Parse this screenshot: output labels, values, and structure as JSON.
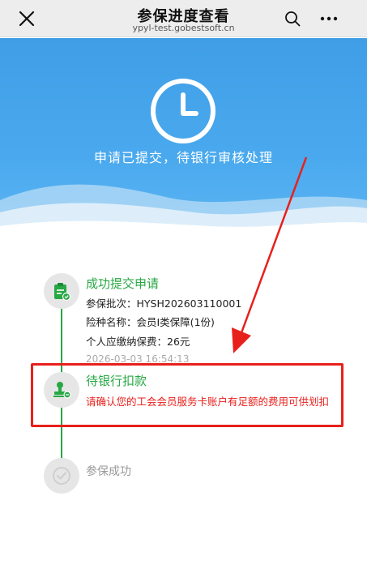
{
  "window": {
    "title": "参保进度查看",
    "url": "ypyl-test.gobestsoft.cn"
  },
  "icons": {
    "close": "close-icon",
    "search": "search-icon",
    "more": "more-icon",
    "clock": "clock-icon",
    "submitted": "clipboard-icon",
    "pending": "stamp-icon",
    "done": "check-circle-icon"
  },
  "hero": {
    "message": "申请已提交，待银行审核处理"
  },
  "timeline": {
    "steps": [
      {
        "title": "成功提交申请",
        "details": [
          "参保批次：HYSH202603110001",
          "险种名称：会员I类保障(1份)",
          "个人应缴纳保费：26元"
        ],
        "timestamp": "2026-03-03 16:54:13",
        "status": "completed"
      },
      {
        "title": "待银行扣款",
        "notice": "请确认您的工会会员服务卡账户有足额的费用可供划扣",
        "status": "current"
      },
      {
        "title": "参保成功",
        "status": "pending"
      }
    ]
  },
  "colors": {
    "accent_green": "#27a844",
    "hero_blue": "#4aa9ee",
    "alert_red": "#e8201c",
    "pending_gray": "#999999"
  }
}
